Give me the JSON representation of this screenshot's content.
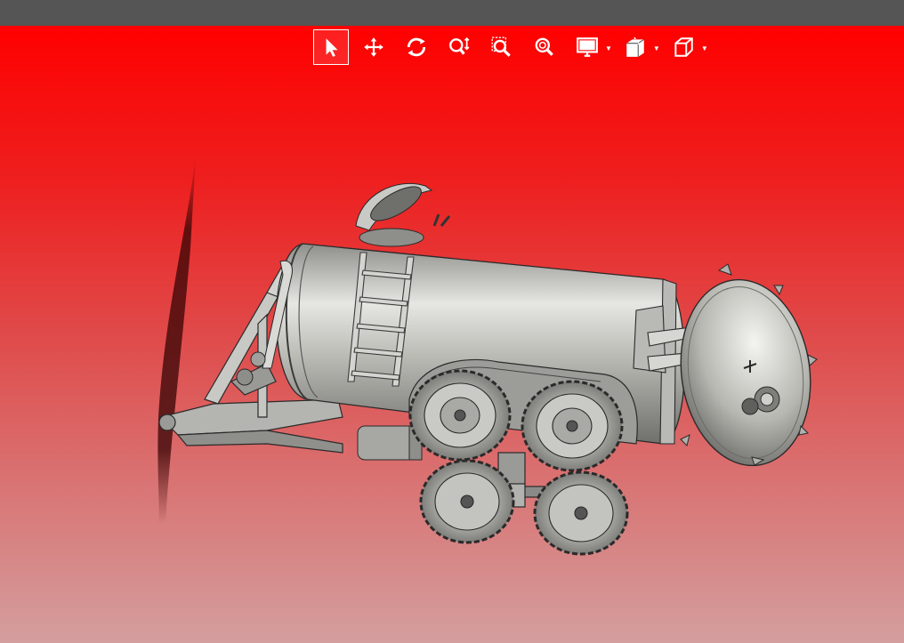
{
  "toolbar": {
    "tools": [
      {
        "id": "select",
        "icon": "cursor-arrow-icon",
        "active": true
      },
      {
        "id": "pan",
        "icon": "pan-arrows-icon"
      },
      {
        "id": "rotate",
        "icon": "rotate-icon"
      },
      {
        "id": "zoom",
        "icon": "zoom-vertical-icon"
      },
      {
        "id": "zoom-window",
        "icon": "zoom-window-icon"
      },
      {
        "id": "zoom-fit",
        "icon": "zoom-fit-icon"
      },
      {
        "id": "display",
        "icon": "monitor-icon",
        "dropdown": true
      },
      {
        "id": "section",
        "icon": "section-view-icon",
        "dropdown": true
      },
      {
        "id": "view-cube",
        "icon": "view-cube-icon",
        "dropdown": true
      }
    ]
  },
  "colors": {
    "topbar": "#555555",
    "viewport_top": "#ff0000",
    "viewport_bottom": "#d49e9e",
    "model_gray": "#a7a7a3",
    "icon": "#ffffff"
  }
}
